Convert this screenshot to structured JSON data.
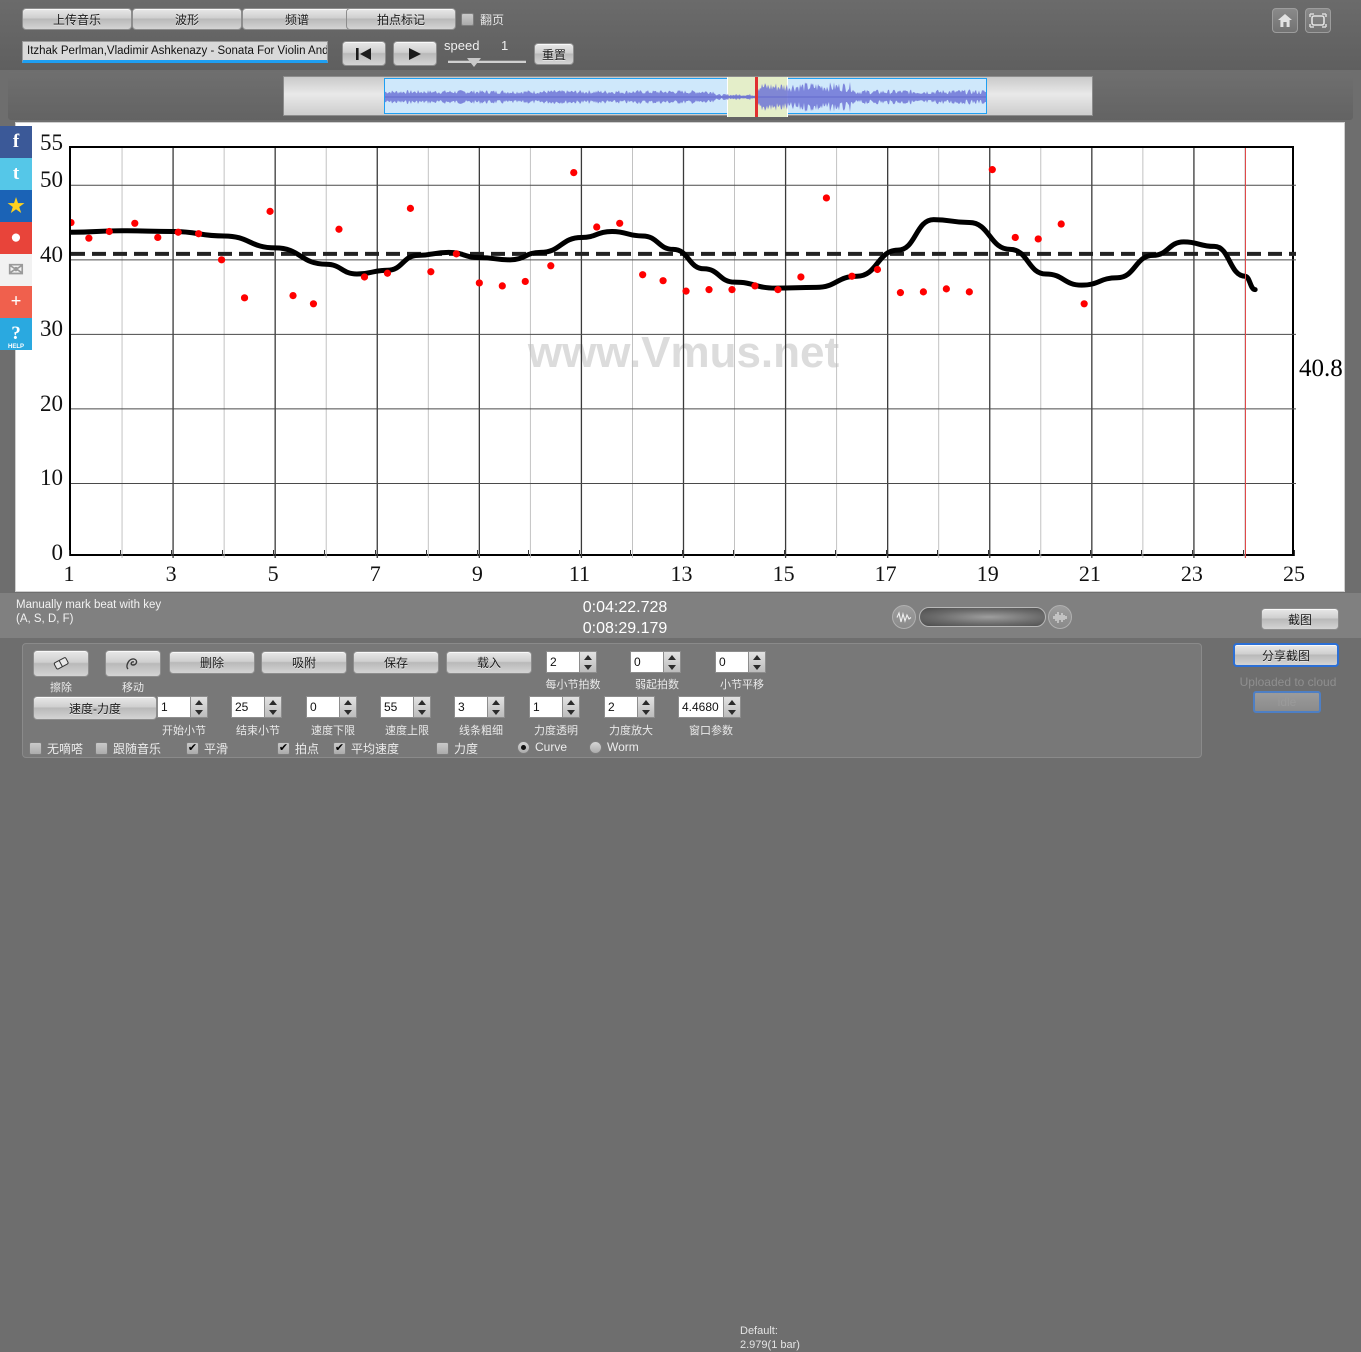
{
  "app": {
    "watermark": "www.Vmus.net"
  },
  "topbar": {
    "buttons": [
      {
        "label": "上传音乐",
        "name": "upload-music-button"
      },
      {
        "label": "波形",
        "name": "waveform-button"
      },
      {
        "label": "频谱",
        "name": "spectrum-button"
      },
      {
        "label": "拍点标记",
        "name": "beat-marker-button"
      }
    ],
    "page_turn_checkbox": {
      "label": "翻页",
      "checked": false
    },
    "song_title": "Itzhak Perlman,Vladimir Ashkenazy - Sonata For Violin And P",
    "speed_label": "speed",
    "speed_value": "1",
    "reset_label": "重置",
    "icons": {
      "home": "home-icon",
      "fullscreen": "fullscreen-icon"
    }
  },
  "status": {
    "hint_line1": "Manually mark beat with key",
    "hint_line2": "(A, S, D, F)",
    "time_current": "0:04:22.728",
    "time_total": "0:08:29.179",
    "screenshot_label": "截图"
  },
  "controls": {
    "tools": [
      {
        "label": "擦除",
        "name": "eraser-tool",
        "icon": "eraser-icon"
      },
      {
        "label": "移动",
        "name": "move-tool",
        "icon": "move-icon"
      }
    ],
    "actions": [
      {
        "label": "删除",
        "name": "delete-button"
      },
      {
        "label": "吸附",
        "name": "snap-button"
      },
      {
        "label": "保存",
        "name": "save-button"
      },
      {
        "label": "载入",
        "name": "load-button"
      }
    ],
    "tempo_force_label": "速度-力度",
    "spinners_row1": [
      {
        "label": "每小节拍数",
        "value": "2",
        "name": "beats-per-bar-spinner"
      },
      {
        "label": "弱起拍数",
        "value": "0",
        "name": "pickup-beats-spinner"
      },
      {
        "label": "小节平移",
        "value": "0",
        "name": "bar-shift-spinner"
      }
    ],
    "spinners_row2": [
      {
        "label": "开始小节",
        "value": "1",
        "name": "start-bar-spinner"
      },
      {
        "label": "结束小节",
        "value": "25",
        "name": "end-bar-spinner"
      },
      {
        "label": "速度下限",
        "value": "0",
        "name": "tempo-min-spinner"
      },
      {
        "label": "速度上限",
        "value": "55",
        "name": "tempo-max-spinner"
      },
      {
        "label": "线条粗细",
        "value": "3",
        "name": "line-width-spinner"
      },
      {
        "label": "力度透明",
        "value": "1",
        "name": "dynamics-opacity-spinner"
      },
      {
        "label": "力度放大",
        "value": "2",
        "name": "dynamics-gain-spinner"
      },
      {
        "label": "窗口参数",
        "value": "4.4680",
        "name": "window-param-spinner"
      }
    ],
    "default_note_line1": "Default:",
    "default_note_line2": "2.979(1 bar)",
    "checkboxes": [
      {
        "label": "无嘀嗒",
        "checked": false,
        "name": "no-tick-checkbox"
      },
      {
        "label": "跟随音乐",
        "checked": false,
        "name": "follow-music-checkbox"
      },
      {
        "label": "平滑",
        "checked": true,
        "name": "smooth-checkbox"
      },
      {
        "label": "拍点",
        "checked": true,
        "name": "beats-checkbox"
      },
      {
        "label": "平均速度",
        "checked": true,
        "name": "average-tempo-checkbox"
      },
      {
        "label": "力度",
        "checked": false,
        "name": "dynamics-checkbox"
      }
    ],
    "radios": [
      {
        "label": "Curve",
        "selected": true,
        "name": "curve-radio"
      },
      {
        "label": "Worm",
        "selected": false,
        "name": "worm-radio"
      }
    ],
    "share_button": "分享截图",
    "cloud_status": "Uploaded to cloud",
    "idle_button": "idle"
  },
  "social": [
    {
      "name": "facebook-icon",
      "glyph": "f",
      "bg": "#3b5998",
      "fg": "#ffffff"
    },
    {
      "name": "twitter-icon",
      "glyph": "t",
      "bg": "#55c7e8",
      "fg": "#ffffff"
    },
    {
      "name": "qzone-star-icon",
      "glyph": "★",
      "bg": "#1b63b6",
      "fg": "#ffd21e"
    },
    {
      "name": "weibo-icon",
      "glyph": "●",
      "bg": "#e8443a",
      "fg": "#ffffff"
    },
    {
      "name": "email-icon",
      "glyph": "✉",
      "bg": "#f2f2f2",
      "fg": "#9a9a9a"
    },
    {
      "name": "share-plus-icon",
      "glyph": "+",
      "bg": "#f0604d",
      "fg": "#ffffff"
    },
    {
      "name": "help-icon",
      "glyph": "?",
      "bg": "#2aa9e0",
      "fg": "#ffffff"
    }
  ],
  "chart_data": {
    "type": "scatter",
    "title": "",
    "xlabel": "",
    "ylabel": "",
    "xlim": [
      1,
      25
    ],
    "ylim": [
      0,
      55
    ],
    "xticks": [
      1,
      3,
      5,
      7,
      9,
      11,
      13,
      15,
      17,
      19,
      21,
      23,
      25
    ],
    "yticks": [
      0,
      10,
      20,
      30,
      40,
      50,
      55
    ],
    "grid": true,
    "average_line": {
      "value": 40.8,
      "label": "40.8",
      "style": "dashed"
    },
    "cursor_x": 24.0,
    "series": [
      {
        "name": "beat tempo",
        "type": "scatter",
        "color": "#ff0000",
        "points": [
          [
            1.0,
            45.0
          ],
          [
            1.35,
            42.9
          ],
          [
            1.75,
            43.8
          ],
          [
            2.25,
            44.9
          ],
          [
            2.7,
            43.0
          ],
          [
            3.1,
            43.7
          ],
          [
            3.5,
            43.5
          ],
          [
            3.95,
            40.0
          ],
          [
            4.4,
            34.9
          ],
          [
            4.9,
            46.5
          ],
          [
            5.35,
            35.2
          ],
          [
            5.75,
            34.1
          ],
          [
            6.25,
            44.1
          ],
          [
            6.75,
            37.7
          ],
          [
            7.2,
            38.2
          ],
          [
            7.65,
            46.9
          ],
          [
            8.05,
            38.4
          ],
          [
            8.55,
            40.8
          ],
          [
            9.0,
            36.9
          ],
          [
            9.45,
            36.5
          ],
          [
            9.9,
            37.1
          ],
          [
            10.4,
            39.2
          ],
          [
            10.85,
            51.7
          ],
          [
            11.3,
            44.4
          ],
          [
            11.75,
            44.9
          ],
          [
            12.2,
            38.0
          ],
          [
            12.6,
            37.2
          ],
          [
            13.05,
            35.8
          ],
          [
            13.5,
            36.0
          ],
          [
            13.95,
            36.0
          ],
          [
            14.4,
            36.5
          ],
          [
            14.85,
            36.0
          ],
          [
            15.3,
            37.7
          ],
          [
            15.8,
            48.3
          ],
          [
            16.3,
            37.8
          ],
          [
            16.8,
            38.7
          ],
          [
            17.25,
            35.6
          ],
          [
            17.7,
            35.7
          ],
          [
            18.15,
            36.1
          ],
          [
            18.6,
            35.7
          ],
          [
            19.05,
            52.1
          ],
          [
            19.5,
            43.0
          ],
          [
            19.95,
            42.8
          ],
          [
            20.4,
            44.8
          ],
          [
            20.85,
            34.1
          ]
        ]
      },
      {
        "name": "smoothed tempo curve",
        "type": "line",
        "color": "#000000",
        "points": [
          [
            1.0,
            43.7
          ],
          [
            2.0,
            43.9
          ],
          [
            3.0,
            43.8
          ],
          [
            4.0,
            43.2
          ],
          [
            5.0,
            41.6
          ],
          [
            6.0,
            39.4
          ],
          [
            6.6,
            38.1
          ],
          [
            7.2,
            38.6
          ],
          [
            7.8,
            40.6
          ],
          [
            8.4,
            41.0
          ],
          [
            9.0,
            40.3
          ],
          [
            9.6,
            40.0
          ],
          [
            10.2,
            41.0
          ],
          [
            11.0,
            43.0
          ],
          [
            11.6,
            43.8
          ],
          [
            12.2,
            43.2
          ],
          [
            12.8,
            41.4
          ],
          [
            13.4,
            38.8
          ],
          [
            14.0,
            37.0
          ],
          [
            14.8,
            36.2
          ],
          [
            15.6,
            36.3
          ],
          [
            16.4,
            37.8
          ],
          [
            17.2,
            41.3
          ],
          [
            17.9,
            45.4
          ],
          [
            18.6,
            45.0
          ],
          [
            19.4,
            41.4
          ],
          [
            20.1,
            38.1
          ],
          [
            20.8,
            36.6
          ],
          [
            21.5,
            37.6
          ],
          [
            22.2,
            40.6
          ],
          [
            22.8,
            42.4
          ],
          [
            23.4,
            41.8
          ],
          [
            24.0,
            37.8
          ],
          [
            24.2,
            36.0
          ]
        ]
      }
    ]
  }
}
